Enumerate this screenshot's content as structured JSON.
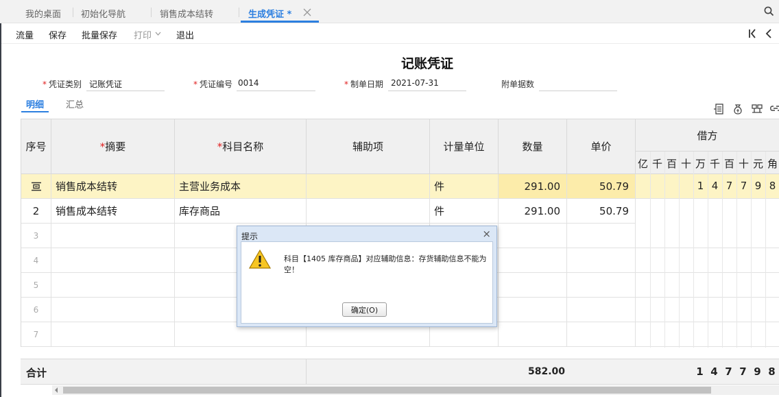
{
  "tabs": [
    {
      "label": "我的桌面"
    },
    {
      "label": "初始化导航"
    },
    {
      "label": "销售成本结转"
    },
    {
      "label": "生成凭证 *"
    }
  ],
  "toolbar": {
    "flow": "流量",
    "save": "保存",
    "batch_save": "批量保存",
    "print": "打印",
    "exit": "退出"
  },
  "voucher": {
    "title": "记账凭证",
    "type_label": "凭证类别",
    "type_value": "记账凭证",
    "number_label": "凭证编号",
    "number_value": "0014",
    "date_label": "制单日期",
    "date_value": "2021-07-31",
    "attach_label": "附单据数",
    "attach_value": ""
  },
  "subtabs": {
    "detail": "明细",
    "summary": "汇总"
  },
  "table": {
    "headers": {
      "seq": "序号",
      "summary": "摘要",
      "account": "科目名称",
      "aux": "辅助项",
      "unit": "计量单位",
      "qty": "数量",
      "price": "单价",
      "debit": "借方"
    },
    "amount_units": [
      "亿",
      "千",
      "百",
      "十",
      "万",
      "千",
      "百",
      "十",
      "元",
      "角"
    ],
    "rows": [
      {
        "seq": "",
        "summary": "销售成本结转",
        "account": "主营业务成本",
        "aux": "",
        "unit": "件",
        "qty": "291.00",
        "price": "50.79",
        "debit_digits": [
          "",
          "",
          "",
          "",
          "1",
          "4",
          "7",
          "7",
          "9",
          "8"
        ]
      },
      {
        "seq": "2",
        "summary": "销售成本结转",
        "account": "库存商品",
        "aux": "",
        "unit": "件",
        "qty": "291.00",
        "price": "50.79",
        "debit_digits": [
          "",
          "",
          "",
          "",
          "",
          "",
          "",
          "",
          "",
          ""
        ]
      },
      {
        "seq": "3"
      },
      {
        "seq": "4"
      },
      {
        "seq": "5"
      },
      {
        "seq": "6"
      },
      {
        "seq": "7"
      }
    ],
    "total_label": "合计",
    "total_qty": "582.00",
    "total_digits": [
      "",
      "",
      "",
      "",
      "1",
      "4",
      "7",
      "7",
      "9",
      "8"
    ]
  },
  "dialog": {
    "title": "提示",
    "close": "×",
    "message": "科目【1405 库存商品】对应辅助信息：存货辅助信息不能为空！",
    "ok": "确定(O)"
  },
  "colors": {
    "accent": "#2c7fe0",
    "selected_row": "#fdf4c5",
    "required": "#e02020"
  }
}
